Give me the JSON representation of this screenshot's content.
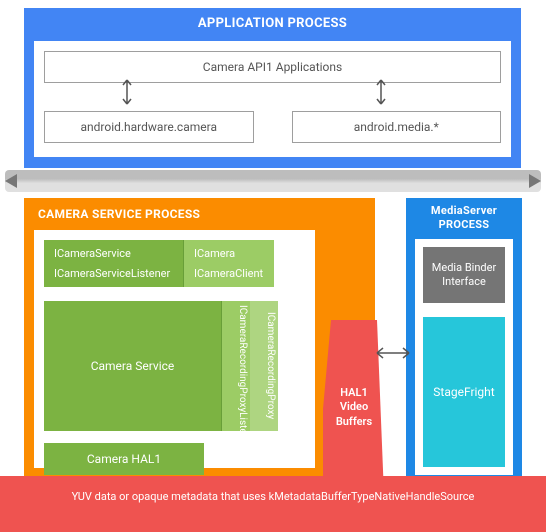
{
  "app_process": {
    "title": "APPLICATION PROCESS",
    "api_apps": "Camera API1 Applications",
    "box_left": "android.hardware.camera",
    "box_right": "android.media.*"
  },
  "csp": {
    "title": "CAMERA SERVICE PROCESS",
    "icamera_service": "ICameraService",
    "icamera": "ICamera",
    "icamera_service_listener": "ICameraServiceListener",
    "icamera_client": "ICameraClient",
    "camera_service": "Camera Service",
    "proxy_listener": "ICameraRecordingProxyListener",
    "proxy": "ICameraRecordingProxy",
    "hal1": "Camera HAL1"
  },
  "msp": {
    "title_line1": "MediaServer",
    "title_line2": "PROCESS",
    "binder": "Media Binder Interface",
    "stagefright": "StageFright"
  },
  "hal_video": "HAL1 Video Buffers",
  "footer": "YUV data or opaque metadata that uses kMetadataBufferTypeNativeHandleSource"
}
